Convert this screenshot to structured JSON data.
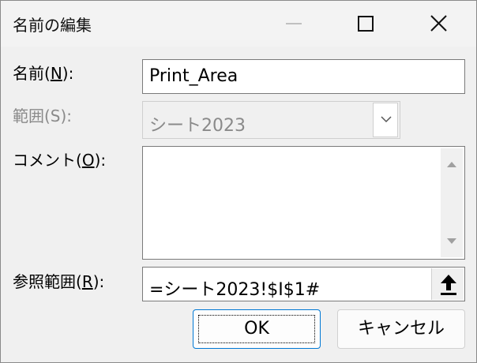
{
  "window": {
    "title": "名前の編集"
  },
  "form": {
    "name_label": {
      "pre": "名前(",
      "key": "N",
      "post": "):"
    },
    "name_value": "Print_Area",
    "scope_label": "範囲(S):",
    "scope_value": "シート2023",
    "comment_label": {
      "pre": "コメント(",
      "key": "O",
      "post": "):"
    },
    "comment_value": "",
    "refers_label": {
      "pre": "参照範囲(",
      "key": "R",
      "post": "):"
    },
    "refers_value": "=シート2023!$I$1#"
  },
  "buttons": {
    "ok_label": "OK",
    "cancel_label": "キャンセル"
  },
  "colors": {
    "accent": "#0078d4",
    "disabled_text": "#8a8a8a"
  },
  "icons": {
    "minimize": "minimize-icon",
    "maximize": "maximize-icon",
    "close": "close-icon",
    "dropdown": "chevron-down-icon",
    "scroll_up": "triangle-up-icon",
    "scroll_down": "triangle-down-icon",
    "collapse": "arrow-up-icon"
  }
}
